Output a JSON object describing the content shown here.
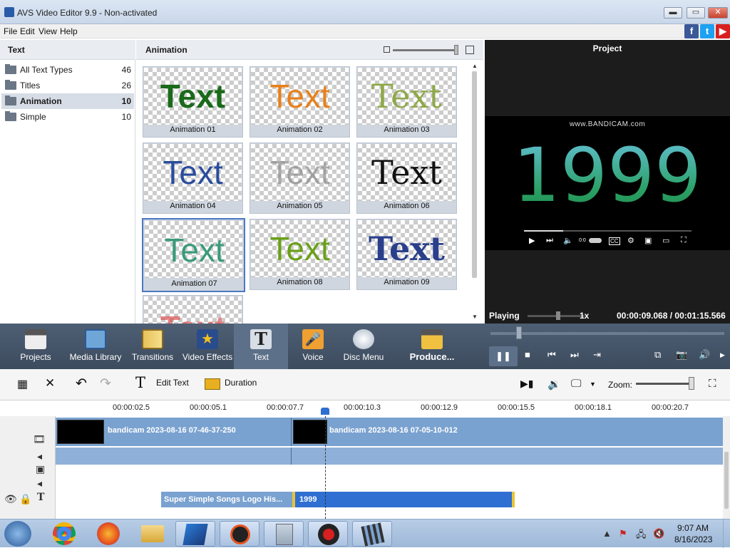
{
  "window": {
    "title": "AVS Video Editor 9.9 - Non-activated",
    "min": "▬",
    "max": "▭",
    "close": "✕"
  },
  "menu": [
    "File",
    "Edit",
    "View",
    "Help"
  ],
  "social": {
    "fb": "f",
    "tw": "t",
    "yt": "▶"
  },
  "left_panel": {
    "header": "Text",
    "categories": [
      {
        "label": "All Text Types",
        "count": "46"
      },
      {
        "label": "Titles",
        "count": "26"
      },
      {
        "label": "Animation",
        "count": "10"
      },
      {
        "label": "Simple",
        "count": "10"
      }
    ]
  },
  "center_panel": {
    "header": "Animation",
    "tiles": [
      {
        "word": "Text",
        "caption": "Animation 01",
        "color": "#1a7a1a"
      },
      {
        "word": "Text",
        "caption": "Animation 02",
        "color": "#e87a10"
      },
      {
        "word": "Text",
        "caption": "Animation 03",
        "color": "#8fa848"
      },
      {
        "word": "Text",
        "caption": "Animation 04",
        "color": "#2a4c9c"
      },
      {
        "word": "Text",
        "caption": "Animation 05",
        "color": "#8a8a8a"
      },
      {
        "word": "Text",
        "caption": "Animation 06",
        "color": "#111111"
      },
      {
        "word": "Text",
        "caption": "Animation 07",
        "color": "#3a9a7a"
      },
      {
        "word": "Text",
        "caption": "Animation 08",
        "color": "#6aa018"
      },
      {
        "word": "Text",
        "caption": "Animation 09",
        "color": "#2a3f8c"
      },
      {
        "word": "Text",
        "caption": "",
        "color": "#d83a3a"
      }
    ]
  },
  "preview": {
    "title": "Project",
    "watermark": "www.BANDICAM.com",
    "number": "1999",
    "yt_time": "0:0",
    "status": "Playing",
    "speed": "1x",
    "timecode": "00:00:09.068  /  00:01:15.566"
  },
  "toolbar": {
    "items": [
      {
        "label": "Projects",
        "color": "#e8e8e8"
      },
      {
        "label": "Media Library",
        "color": "#6fa6d8"
      },
      {
        "label": "Transitions",
        "color": "#e8c05a"
      },
      {
        "label": "Video Effects",
        "color": "#e8b020"
      },
      {
        "label": "Text",
        "color": "#d8dee6"
      },
      {
        "label": "Voice",
        "color": "#f0a030"
      },
      {
        "label": "Disc Menu",
        "color": "#c8d4e0"
      },
      {
        "label": "Produce...",
        "color": "#f0c040"
      }
    ]
  },
  "editbar": {
    "edit_text": "Edit Text",
    "duration": "Duration",
    "zoom": "Zoom:"
  },
  "timeline": {
    "ticks": [
      "00:00:02.5",
      "00:00:05.1",
      "00:00:07.7",
      "00:00:10.3",
      "00:00:12.9",
      "00:00:15.5",
      "00:00:18.1",
      "00:00:20.7"
    ],
    "clip1": "bandicam 2023-08-16 07-46-37-250",
    "clip2": "bandicam 2023-08-16 07-05-10-012",
    "text_clip1": "Super Simple Songs Logo His...",
    "text_clip2": "1999"
  },
  "taskbar": {
    "time": "9:07 AM",
    "date": "8/16/2023"
  }
}
